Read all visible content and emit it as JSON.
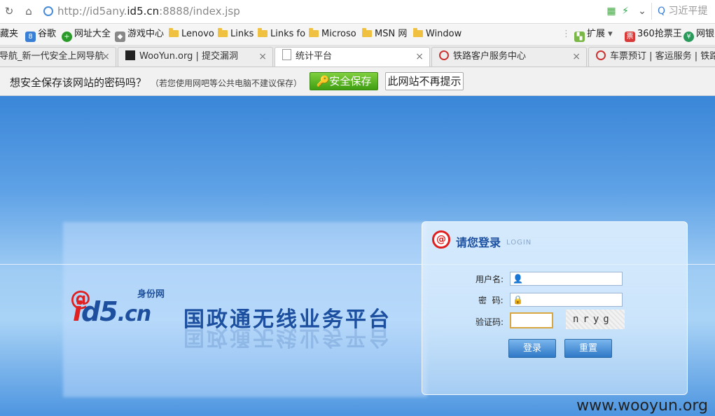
{
  "browser": {
    "url_prefix": "http://id5any.",
    "url_domain": "id5.cn",
    "url_suffix": ":8888/index.jsp",
    "search_text": "习近平提"
  },
  "bookmarks": [
    {
      "label": "藏夹",
      "icon": "none"
    },
    {
      "label": "谷歌",
      "icon": "google-icon"
    },
    {
      "label": "网址大全",
      "icon": "site-nav-icon"
    },
    {
      "label": "游戏中心",
      "icon": "gamepad-icon"
    },
    {
      "label": "Lenovo",
      "icon": "folder-icon"
    },
    {
      "label": "Links",
      "icon": "folder-icon"
    },
    {
      "label": "Links fo",
      "icon": "folder-icon"
    },
    {
      "label": "Microso",
      "icon": "folder-icon"
    },
    {
      "label": "MSN 网",
      "icon": "folder-icon"
    },
    {
      "label": "Window",
      "icon": "folder-icon"
    }
  ],
  "bookmark_extras": {
    "ext_label": "扩展",
    "ticket_label": "360抢票王",
    "bank_label": "网银"
  },
  "tabs": [
    {
      "label": "导航_新一代安全上网导航",
      "active": false
    },
    {
      "label": "WooYun.org | 提交漏洞",
      "active": false
    },
    {
      "label": "统计平台",
      "active": true
    },
    {
      "label": "铁路客户服务中心",
      "active": false
    },
    {
      "label": "车票预订 | 客运服务 | 铁路客",
      "active": false
    }
  ],
  "password_bar": {
    "message": "想安全保存该网站的密码吗？",
    "note": "（若您使用网吧等公共电脑不建议保存）",
    "save_label": "安全保存",
    "never_label": "此网站不再提示"
  },
  "page": {
    "logo_text_i": "i",
    "logo_text_d5": "d5",
    "logo_text_cn": ".cn",
    "logo_sub": "身份网",
    "platform_title": "国政通无线业务平台",
    "login": {
      "title": "请您登录",
      "subtitle": "LOGIN",
      "username_label": "用户名:",
      "password_label": "密  码:",
      "captcha_label": "验证码:",
      "captcha_text": "nryg",
      "login_button": "登录",
      "reset_button": "重置"
    },
    "watermark": "www.wooyun.org"
  }
}
